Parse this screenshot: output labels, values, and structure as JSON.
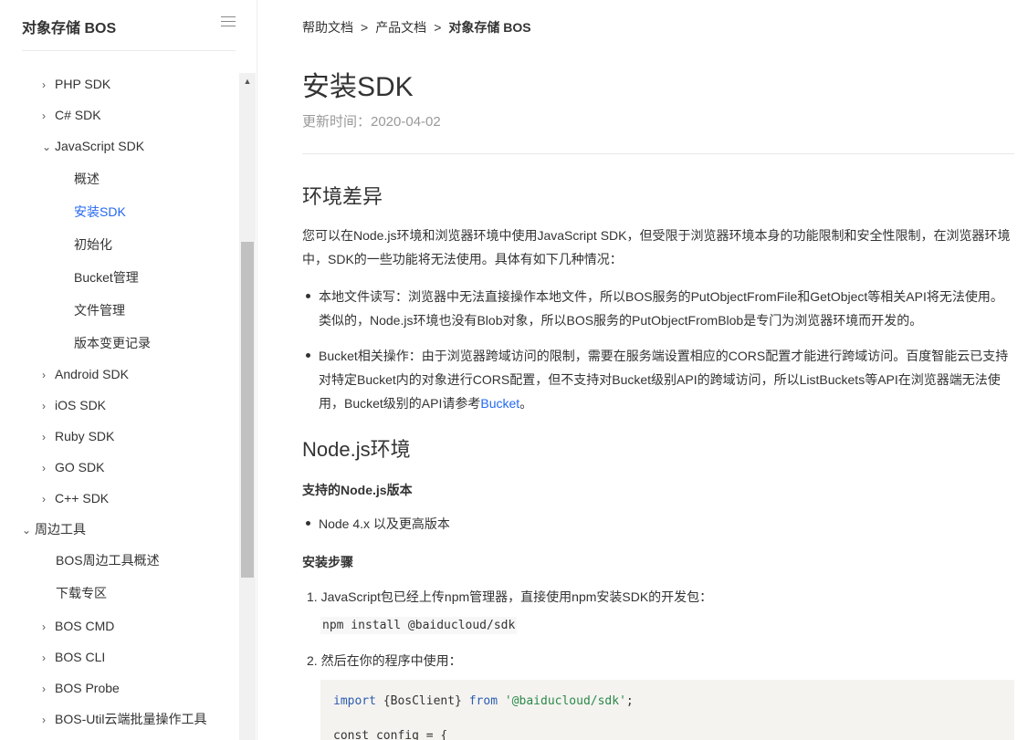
{
  "sidebar": {
    "title": "对象存储 BOS",
    "menu_icon": "hamburger-menu-icon",
    "items": [
      {
        "label": "PHP SDK",
        "chev": "›",
        "level": 1
      },
      {
        "label": "C# SDK",
        "chev": "›",
        "level": 1
      },
      {
        "label": "JavaScript SDK",
        "chev": "⌄",
        "level": 1
      },
      {
        "label": "概述",
        "chev": "",
        "level": 2
      },
      {
        "label": "安装SDK",
        "chev": "",
        "level": 2,
        "active": true
      },
      {
        "label": "初始化",
        "chev": "",
        "level": 2
      },
      {
        "label": "Bucket管理",
        "chev": "",
        "level": 2
      },
      {
        "label": "文件管理",
        "chev": "",
        "level": 2
      },
      {
        "label": "版本变更记录",
        "chev": "",
        "level": 2
      },
      {
        "label": "Android SDK",
        "chev": "›",
        "level": 1
      },
      {
        "label": "iOS SDK",
        "chev": "›",
        "level": 1
      },
      {
        "label": "Ruby SDK",
        "chev": "›",
        "level": 1
      },
      {
        "label": "GO SDK",
        "chev": "›",
        "level": 1
      },
      {
        "label": "C++ SDK",
        "chev": "›",
        "level": 1
      },
      {
        "label": "周边工具",
        "chev": "⌄",
        "level": 0
      },
      {
        "label": "BOS周边工具概述",
        "chev": "",
        "level": 1
      },
      {
        "label": "下载专区",
        "chev": "",
        "level": 1
      },
      {
        "label": "BOS CMD",
        "chev": "›",
        "level": 1
      },
      {
        "label": "BOS CLI",
        "chev": "›",
        "level": 1
      },
      {
        "label": "BOS Probe",
        "chev": "›",
        "level": 1
      },
      {
        "label": "BOS-Util云端批量操作工具",
        "chev": "›",
        "level": 1
      }
    ]
  },
  "breadcrumb": {
    "items": [
      "帮助文档",
      "产品文档",
      "对象存储 BOS"
    ],
    "separator": ">"
  },
  "page": {
    "title": "安装SDK",
    "update_time": "更新时间：2020-04-02"
  },
  "section1": {
    "heading": "环境差异",
    "intro": "您可以在Node.js环境和浏览器环境中使用JavaScript SDK，但受限于浏览器环境本身的功能限制和安全性限制，在浏览器环境中，SDK的一些功能将无法使用。具体有如下几种情况：",
    "bullet1": "本地文件读写：浏览器中无法直接操作本地文件，所以BOS服务的PutObjectFromFile和GetObject等相关API将无法使用。类似的，Node.js环境也没有Blob对象，所以BOS服务的PutObjectFromBlob是专门为浏览器环境而开发的。",
    "bullet2_text": "Bucket相关操作：由于浏览器跨域访问的限制，需要在服务端设置相应的CORS配置才能进行跨域访问。百度智能云已支持对特定Bucket内的对象进行CORS配置，但不支持对Bucket级别API的跨域访问，所以ListBuckets等API在浏览器端无法使用，Bucket级别的API请参考",
    "bullet2_link": "Bucket",
    "bullet2_end": "。"
  },
  "section2": {
    "heading": "Node.js环境",
    "versions_label": "支持的Node.js版本",
    "version_item": "Node 4.x 以及更高版本",
    "steps_label": "安装步骤",
    "step1": "1. JavaScript包已经上传npm管理器，直接使用npm安装SDK的开发包：",
    "step1_code": "npm install @baiducloud/sdk",
    "step2": "2. 然后在你的程序中使用：",
    "code_import_kw": "import",
    "code_import_names": " {BosClient} ",
    "code_from_kw": "from",
    "code_module": "'@baiducloud/sdk'",
    "code_semicolon": ";",
    "code_line2": "const config = {"
  },
  "colors": {
    "accent": "#2468f2",
    "text": "#333333",
    "muted": "#999999",
    "code_bg": "#f5f3f0"
  }
}
